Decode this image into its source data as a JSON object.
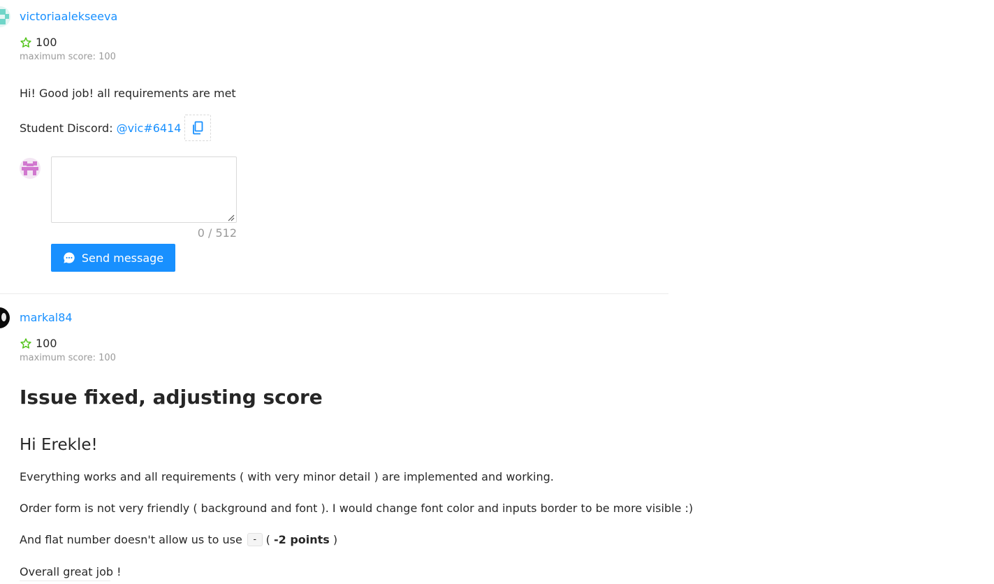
{
  "reviews": [
    {
      "username": "victoriaalekseeva",
      "score": "100",
      "max_score": "maximum score: 100",
      "comment": "Hi! Good job! all requirements are met"
    },
    {
      "username": "markal84",
      "score": "100",
      "max_score": "maximum score: 100",
      "heading": "Issue fixed, adjusting score",
      "subheading": "Hi Erekle!",
      "paragraphs": [
        "Everything works and all requirements ( with very minor detail ) are implemented and working.",
        "Order form is not very friendly ( background and font ). I would change font color and inputs border to be more visible :)"
      ],
      "flat_line": {
        "prefix": "And flat number doesn't allow us to use",
        "code": "-",
        "open": "(",
        "points": "-2 points",
        "close": ")"
      },
      "closing": "Overall great job !"
    }
  ],
  "discord": {
    "label": "Student Discord:",
    "handle": "@vic#6414"
  },
  "reply": {
    "value": "",
    "char_count": "0 / 512",
    "send_label": "Send message"
  },
  "colors": {
    "link": "#1890ff",
    "primary_button": "#1890ff",
    "star": "#52c41a",
    "muted": "#9a9a9a"
  },
  "icons": {
    "score": "star-outline-icon",
    "copy": "copy-icon",
    "send": "message-bubble-icon"
  }
}
